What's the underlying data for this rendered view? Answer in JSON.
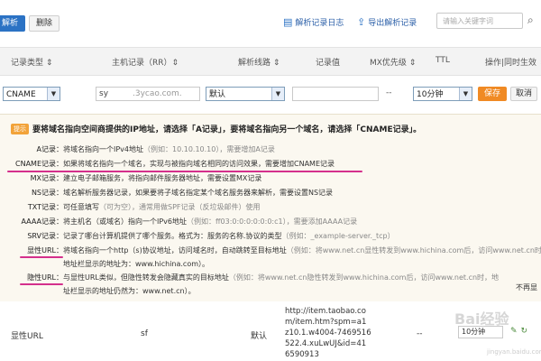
{
  "toolbar": {
    "parse_label": "解析",
    "delete_label": "删除",
    "log_link": "解析记录日志",
    "export_link": "导出解析记录",
    "search_placeholder": "请输入关键字词"
  },
  "header": {
    "cols": [
      "记录类型 ⇕",
      "主机记录（RR）⇕",
      "解析线路 ⇕",
      "记录值",
      "MX优先级 ⇕",
      "TTL",
      "操作|同时生效 ⇕"
    ]
  },
  "edit_row": {
    "type_value": "CNAME",
    "host_value": "sy",
    "domain_suffix": ".3ycao.com.",
    "line_value": "默认",
    "mx_value": "--",
    "ttl_value": "10分钟",
    "save_label": "保存",
    "cancel_label": "取消"
  },
  "help": {
    "badge": "提示",
    "title": "要将域名指向空间商提供的IP地址，请选择「A记录」，要将域名指向另一个域名，请选择「CNAME记录」。",
    "lines": [
      {
        "label": "A记录：",
        "text": "将域名指向一个IPv4地址",
        "example": "（例如：10.10.10.10），需要增加A记录"
      },
      {
        "label": "CNAME记录：",
        "text": "如果将域名指向一个域名，实现与被指向域名相同的访问效果，需要增加CNAME记录",
        "example": ""
      },
      {
        "label": "MX记录：",
        "text": "建立电子邮箱服务，将指向邮件服务器地址，需要设置MX记录",
        "example": ""
      },
      {
        "label": "NS记录：",
        "text": "域名解析服务器记录，如果要将子域名指定某个域名服务器来解析，需要设置NS记录",
        "example": ""
      },
      {
        "label": "TXT记录：",
        "text": "可任意填写",
        "example": "（可为空），通常用做SPF记录（反垃圾邮件）使用"
      },
      {
        "label": "AAAA记录：",
        "text": "将主机名（或域名）指向一个IPv6地址",
        "example": "（例如：ff03:0:0:0:0:0:0:c1），需要添加AAAA记录"
      },
      {
        "label": "SRV记录：",
        "text": "记录了哪台计算机提供了哪个服务。格式为：服务的名称.协议的类型",
        "example": "（例如：_example-server._tcp）"
      },
      {
        "label": "显性URL：",
        "text": "将域名指向一个http（s)协议地址，访问域名时，自动跳转至目标地址",
        "example": "（例如：将www.net.cn显性转发到www.hichina.com后，访问www.net.cn时，"
      },
      {
        "label": "",
        "text": "地址栏显示的地址为：www.hichina.com）。",
        "example": ""
      },
      {
        "label": "隐性URL：",
        "text": "与显性URL类似，但隐性转发会隐藏真实的目标地址",
        "example": "（例如：将www.net.cn隐性转发到www.hichina.com后，访问www.net.cn时，地"
      },
      {
        "label": "",
        "text": "址栏显示的地址仍然为：www.net.cn）。",
        "example": ""
      }
    ],
    "no_show": "不再显"
  },
  "data_row": {
    "type": "显性URL",
    "host": "sf",
    "line": "默认",
    "value_lines": [
      "http://item.taobao.co",
      "m/item.htm?spm=a1",
      "z10.1.w4004-7469516",
      "522.4.xuLwUJ&id=41",
      "6590913"
    ],
    "mx": "--",
    "ttl": "10分钟"
  },
  "watermark": {
    "text": "Bai经验",
    "sub": "jingyan.baidu.com"
  },
  "colors": {
    "primary": "#2b72c4",
    "save": "#f08a24",
    "highlight": "#d4308c",
    "help_bg": "#fbf8f0"
  }
}
